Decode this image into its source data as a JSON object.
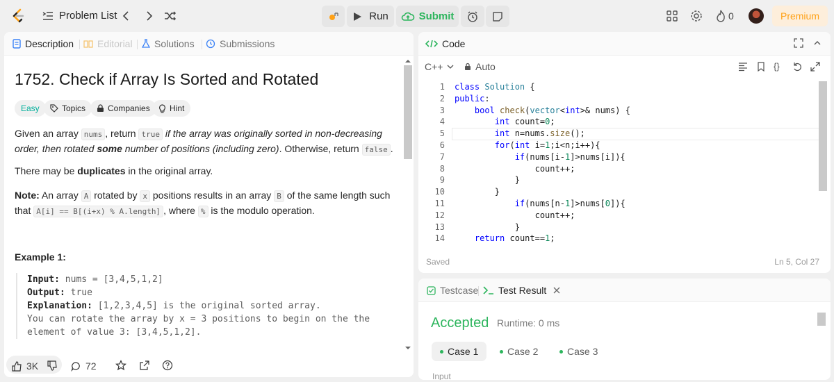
{
  "topbar": {
    "problem_list_label": "Problem List",
    "run_label": "Run",
    "submit_label": "Submit",
    "streak_count": "0",
    "premium_label": "Premium",
    "accent_color": "#ffa116",
    "success_color": "#2db55d"
  },
  "left_tabs": {
    "description": "Description",
    "editorial": "Editorial",
    "solutions": "Solutions",
    "submissions": "Submissions"
  },
  "problem": {
    "title": "1752. Check if Array Is Sorted and Rotated",
    "difficulty": "Easy",
    "chips": {
      "topics": "Topics",
      "companies": "Companies",
      "hint": "Hint"
    },
    "para1": {
      "t1": "Given an array ",
      "c1": "nums",
      "t2": ", return ",
      "c2": "true",
      "t3": " ",
      "i1": "if the array was originally sorted in non-decreasing order, then rotated ",
      "b1": "some",
      "i2": " number of positions (including zero)",
      "t4": ". Otherwise, return ",
      "c3": "false",
      "t5": "."
    },
    "para2": {
      "t1": "There may be ",
      "b1": "duplicates",
      "t2": " in the original array."
    },
    "para3": {
      "b1": "Note:",
      "t1": " An array ",
      "c1": "A",
      "t2": " rotated by ",
      "c2": "x",
      "t3": " positions results in an array ",
      "c3": "B",
      "t4": " of the same length such that ",
      "c4": "A[i] == B[(i+x) % A.length]",
      "t5": ", where ",
      "c5": "%",
      "t6": " is the modulo operation."
    },
    "example1": {
      "title": "Example 1:",
      "input_label": "Input:",
      "input_value": " nums = [3,4,5,1,2]",
      "output_label": "Output:",
      "output_value": " true",
      "explanation_label": "Explanation:",
      "explanation_line1": " [1,2,3,4,5] is the original sorted array.",
      "explanation_line2": "You can rotate the array by x = 3 positions to begin on the the",
      "explanation_line3": "element of value 3: [3,4,5,1,2]."
    }
  },
  "footer": {
    "likes": "3K",
    "comments": "72"
  },
  "code_panel": {
    "title": "Code",
    "language": "C++",
    "mode": "Auto",
    "saved_label": "Saved",
    "cursor_pos": "Ln 5, Col 27",
    "line_numbers": [
      "1",
      "2",
      "3",
      "4",
      "5",
      "6",
      "7",
      "8",
      "9",
      "10",
      "11",
      "12",
      "13",
      "14"
    ]
  },
  "test_panel": {
    "testcase_tab": "Testcase",
    "result_tab": "Test Result",
    "status": "Accepted",
    "runtime": "Runtime: 0 ms",
    "cases": [
      "Case 1",
      "Case 2",
      "Case 3"
    ],
    "cut_label": "Input"
  }
}
